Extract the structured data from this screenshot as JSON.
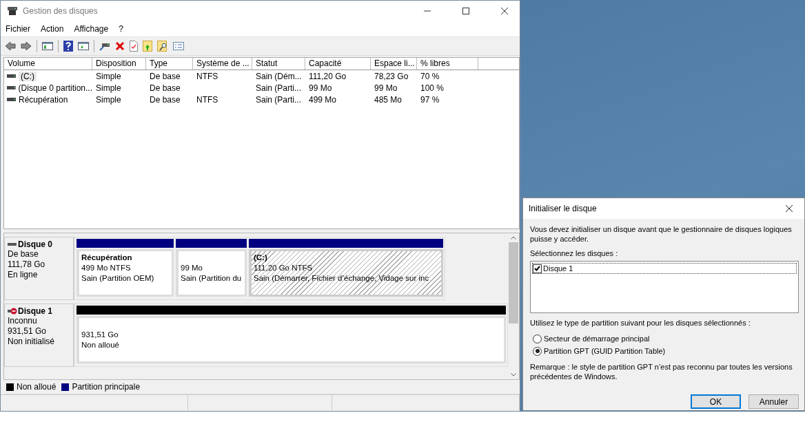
{
  "window": {
    "title": "Gestion des disques"
  },
  "menu": [
    "Fichier",
    "Action",
    "Affichage",
    "?"
  ],
  "table": {
    "columns": [
      "Volume",
      "Disposition",
      "Type",
      "Système de ...",
      "Statut",
      "Capacité",
      "Espace li...",
      "% libres"
    ],
    "rows": [
      {
        "selected": true,
        "cells": [
          "(C:)",
          "Simple",
          "De base",
          "NTFS",
          "Sain (Dém...",
          "111,20 Go",
          "78,23 Go",
          "70 %"
        ]
      },
      {
        "selected": false,
        "cells": [
          "(Disque 0 partition...",
          "Simple",
          "De base",
          "",
          "Sain (Parti...",
          "99 Mo",
          "99 Mo",
          "100 %"
        ]
      },
      {
        "selected": false,
        "cells": [
          "Récupération",
          "Simple",
          "De base",
          "NTFS",
          "Sain (Parti...",
          "499 Mo",
          "485 Mo",
          "97 %"
        ]
      }
    ]
  },
  "disks": [
    {
      "name": "Disque 0",
      "alert": false,
      "details": [
        "De base",
        "111,78 Go",
        "En ligne"
      ],
      "partitions": [
        {
          "kind": "primary",
          "selected": false,
          "name": "Récupération",
          "lines": [
            "499 Mo NTFS",
            "Sain (Partition OEM)"
          ]
        },
        {
          "kind": "primary",
          "selected": false,
          "lines": [
            "99 Mo",
            "Sain (Partition du"
          ]
        },
        {
          "kind": "primary",
          "selected": true,
          "name": "(C:)",
          "lines": [
            "111,20 Go NTFS",
            "Sain (Démarrer, Fichier d’échange, Vidage sur inc"
          ]
        }
      ]
    },
    {
      "name": "Disque 1",
      "alert": true,
      "details": [
        "Inconnu",
        "931,51 Go",
        "Non initialisé"
      ],
      "partitions": [
        {
          "kind": "unallocated",
          "selected": false,
          "lines": [
            "931,51 Go",
            "Non alloué"
          ]
        }
      ]
    }
  ],
  "legend": [
    {
      "label": "Non alloué",
      "color": "#000000"
    },
    {
      "label": "Partition principale",
      "color": "#000080"
    }
  ],
  "dialog": {
    "title": "Initialiser le disque",
    "message": "Vous devez initialiser un disque avant que le gestionnaire de disques logiques puisse y accéder.",
    "list_label": "Sélectionnez les disques :",
    "disks": [
      {
        "label": "Disque 1",
        "checked": true
      }
    ],
    "style_label": "Utilisez le type de partition suivant pour les disques sélectionnés :",
    "options": [
      {
        "label": "Secteur de démarrage principal",
        "selected": false
      },
      {
        "label": "Partition GPT (GUID Partition Table)",
        "selected": true
      }
    ],
    "note": "Remarque : le style de partition GPT n’est pas reconnu par toutes les versions précédentes de Windows.",
    "buttons": [
      {
        "label": "OK",
        "default": true
      },
      {
        "label": "Annuler",
        "default": false
      }
    ]
  }
}
